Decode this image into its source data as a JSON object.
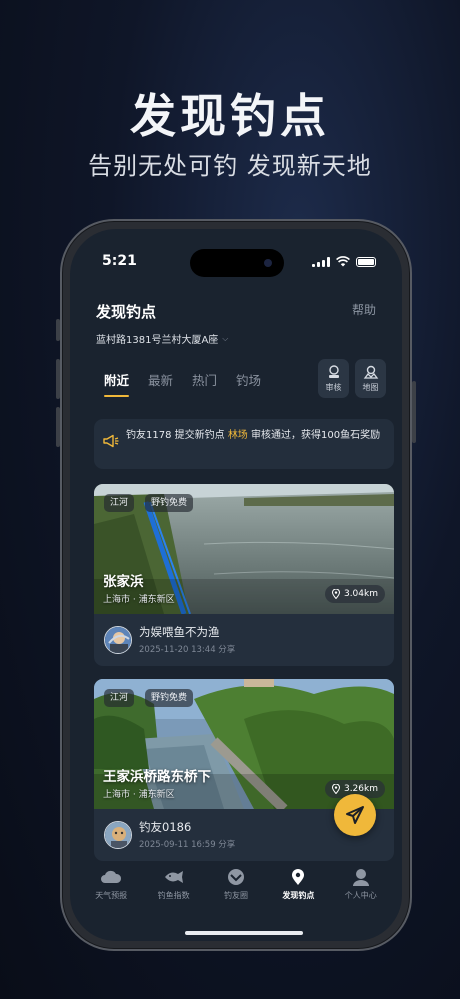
{
  "promo": {
    "title": "发现钓点",
    "subtitle": "告别无处可钓  发现新天地"
  },
  "status_bar": {
    "time": "5:21"
  },
  "header": {
    "title": "发现钓点",
    "help_label": "帮助",
    "address": "蓝村路1381号兰村大厦A座"
  },
  "tabs": [
    {
      "label": "附近",
      "active": true
    },
    {
      "label": "最新",
      "active": false
    },
    {
      "label": "热门",
      "active": false
    },
    {
      "label": "钓场",
      "active": false
    }
  ],
  "tools": {
    "review_label": "审核",
    "map_label": "地图"
  },
  "notice": {
    "prefix": "钓友1178 提交新钓点 ",
    "highlight": "林场",
    "suffix": " 审核通过，获得100鱼石奖励"
  },
  "spots": [
    {
      "tags": [
        "江河",
        "野钓免费"
      ],
      "name": "张家浜",
      "location": "上海市 · 浦东新区",
      "distance": "3.04km",
      "user": "为娱喂鱼不为渔",
      "meta": "2025-11-20 13:44 分享"
    },
    {
      "tags": [
        "江河",
        "野钓免费"
      ],
      "name": "王家浜桥路东桥下",
      "location": "上海市 · 浦东新区",
      "distance": "3.26km",
      "user": "钓友0186",
      "meta": "2025-09-11 16:59 分享"
    }
  ],
  "tabbar": [
    {
      "label": "天气预报",
      "icon": "cloud-icon",
      "active": false
    },
    {
      "label": "钓鱼指数",
      "icon": "fish-icon",
      "active": false
    },
    {
      "label": "钓友圈",
      "icon": "circle-icon",
      "active": false
    },
    {
      "label": "发现钓点",
      "icon": "location-pin-icon",
      "active": true
    },
    {
      "label": "个人中心",
      "icon": "user-icon",
      "active": false
    }
  ],
  "colors": {
    "accent": "#f0b83a",
    "screen_bg": "#1a232f",
    "card_bg": "#242f3d"
  }
}
